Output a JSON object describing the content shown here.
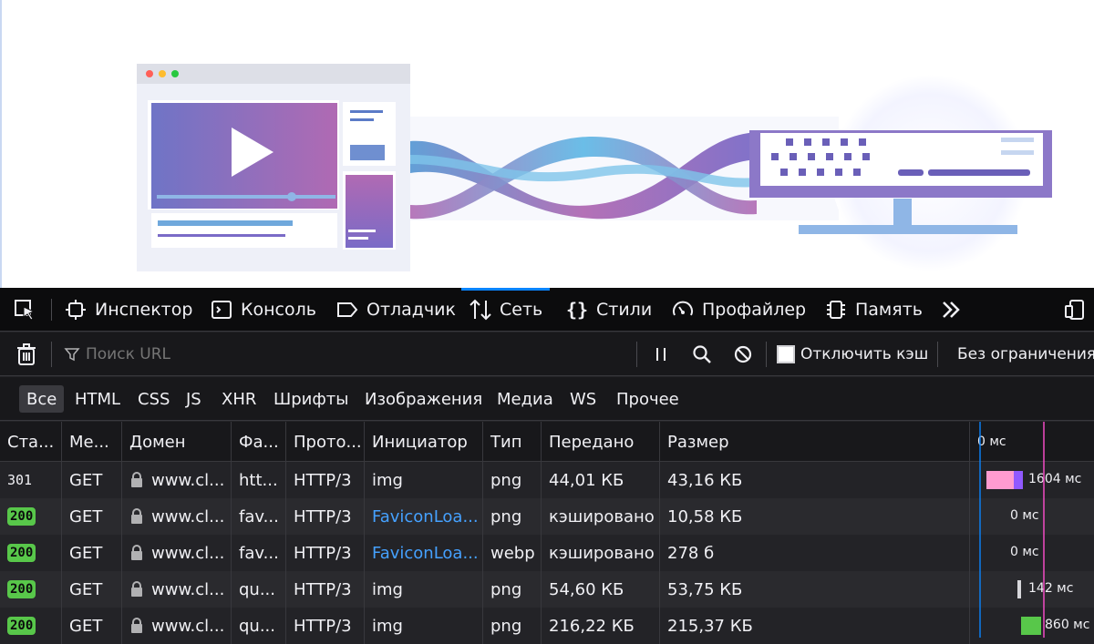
{
  "tabs": [
    {
      "id": "inspector",
      "label": "Инспектор",
      "icon": "inspector-icon",
      "active": false
    },
    {
      "id": "console",
      "label": "Консоль",
      "icon": "console-icon",
      "active": false
    },
    {
      "id": "debugger",
      "label": "Отладчик",
      "icon": "debugger-icon",
      "active": false
    },
    {
      "id": "network",
      "label": "Сеть",
      "icon": "network-arrows-icon",
      "active": true
    },
    {
      "id": "styles",
      "label": "Стили",
      "icon": "braces-icon",
      "active": false
    },
    {
      "id": "profiler",
      "label": "Профайлер",
      "icon": "gauge-icon",
      "active": false
    },
    {
      "id": "memory",
      "label": "Память",
      "icon": "memory-chip-icon",
      "active": false
    }
  ],
  "toolbar": {
    "filter_placeholder": "Поиск URL",
    "disable_cache_label": "Отключить кэш",
    "disable_cache_checked": false,
    "throttle_label": "Без ограничения"
  },
  "filters": [
    "Все",
    "HTML",
    "CSS",
    "JS",
    "XHR",
    "Шрифты",
    "Изображения",
    "Медиа",
    "WS",
    "Прочее"
  ],
  "active_filter": "Все",
  "columns": [
    "Ста...",
    "Ме...",
    "Домен",
    "Фа...",
    "Прото...",
    "Инициатор",
    "Тип",
    "Передано",
    "Размер"
  ],
  "waterfall_header": "0 мс",
  "requests": [
    {
      "status": "301",
      "method": "GET",
      "domain": "www.cl...",
      "file": "htt...",
      "protocol": "HTTP/3",
      "initiator": "img",
      "initiator_link": false,
      "type": "png",
      "transferred": "44,01 КБ",
      "size": "43,16 КБ",
      "timing": "1604 мс"
    },
    {
      "status": "200",
      "method": "GET",
      "domain": "www.cl...",
      "file": "fav...",
      "protocol": "HTTP/3",
      "initiator": "FaviconLoa...",
      "initiator_link": true,
      "type": "png",
      "transferred": "кэшировано",
      "size": "10,58 КБ",
      "timing": "0 мс"
    },
    {
      "status": "200",
      "method": "GET",
      "domain": "www.cl...",
      "file": "fav...",
      "protocol": "HTTP/3",
      "initiator": "FaviconLoa...",
      "initiator_link": true,
      "type": "webp",
      "transferred": "кэшировано",
      "size": "278 б",
      "timing": "0 мс"
    },
    {
      "status": "200",
      "method": "GET",
      "domain": "www.cl...",
      "file": "qu...",
      "protocol": "HTTP/3",
      "initiator": "img",
      "initiator_link": false,
      "type": "png",
      "transferred": "54,60 КБ",
      "size": "53,75 КБ",
      "timing": "142 мс"
    },
    {
      "status": "200",
      "method": "GET",
      "domain": "www.cl...",
      "file": "qu...",
      "protocol": "HTTP/3",
      "initiator": "img",
      "initiator_link": false,
      "type": "png",
      "transferred": "216,22 КБ",
      "size": "215,37 КБ",
      "timing": "860 мс"
    }
  ],
  "colors": {
    "accent": "#0a84ff",
    "status_ok": "#58c74a",
    "link": "#45a1ff",
    "waterfall_pink": "#ff9bd0",
    "waterfall_purple": "#9059ff",
    "waterfall_green": "#58c74a"
  }
}
